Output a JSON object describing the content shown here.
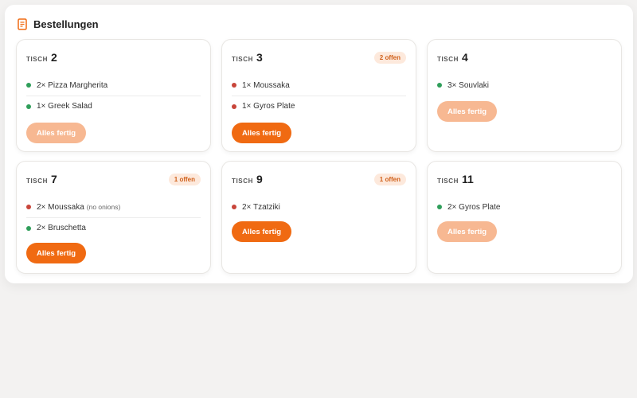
{
  "panel": {
    "title": "Bestellungen",
    "icon": "receipt-icon",
    "accent": "#f06a12"
  },
  "label_tisch": "TISCH",
  "button_label": "Alles fertig",
  "colors": {
    "done": "#2f9e5a",
    "open": "#c8453a",
    "button": "#f06a12",
    "button_disabled": "#f7b892",
    "badge_bg": "#fde9dc"
  },
  "orders": [
    {
      "table": "2",
      "badge": "",
      "button_enabled": false,
      "items": [
        {
          "text": "2× Pizza Margherita",
          "note": "",
          "status": "done"
        },
        {
          "text": "1× Greek Salad",
          "note": "",
          "status": "done"
        }
      ]
    },
    {
      "table": "3",
      "badge": "2 offen",
      "button_enabled": true,
      "items": [
        {
          "text": "1× Moussaka",
          "note": "",
          "status": "open"
        },
        {
          "text": "1× Gyros Plate",
          "note": "",
          "status": "open"
        }
      ]
    },
    {
      "table": "4",
      "badge": "",
      "button_enabled": false,
      "items": [
        {
          "text": "3× Souvlaki",
          "note": "",
          "status": "done"
        }
      ]
    },
    {
      "table": "7",
      "badge": "1 offen",
      "button_enabled": true,
      "items": [
        {
          "text": "2× Moussaka",
          "note": "(no onions)",
          "status": "open"
        },
        {
          "text": "2× Bruschetta",
          "note": "",
          "status": "done"
        }
      ]
    },
    {
      "table": "9",
      "badge": "1 offen",
      "button_enabled": true,
      "items": [
        {
          "text": "2× Tzatziki",
          "note": "",
          "status": "open"
        }
      ]
    },
    {
      "table": "11",
      "badge": "",
      "button_enabled": false,
      "items": [
        {
          "text": "2× Gyros Plate",
          "note": "",
          "status": "done"
        }
      ]
    }
  ]
}
